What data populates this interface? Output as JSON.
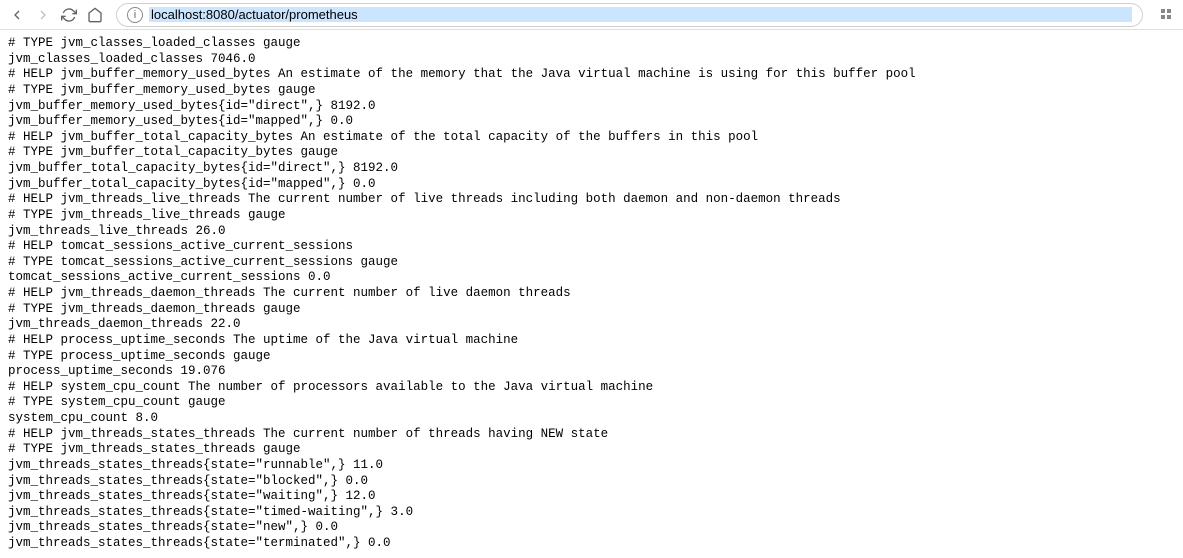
{
  "toolbar": {
    "url": "localhost:8080/actuator/prometheus"
  },
  "lines": [
    "# TYPE jvm_classes_loaded_classes gauge",
    "jvm_classes_loaded_classes 7046.0",
    "# HELP jvm_buffer_memory_used_bytes An estimate of the memory that the Java virtual machine is using for this buffer pool",
    "# TYPE jvm_buffer_memory_used_bytes gauge",
    "jvm_buffer_memory_used_bytes{id=\"direct\",} 8192.0",
    "jvm_buffer_memory_used_bytes{id=\"mapped\",} 0.0",
    "# HELP jvm_buffer_total_capacity_bytes An estimate of the total capacity of the buffers in this pool",
    "# TYPE jvm_buffer_total_capacity_bytes gauge",
    "jvm_buffer_total_capacity_bytes{id=\"direct\",} 8192.0",
    "jvm_buffer_total_capacity_bytes{id=\"mapped\",} 0.0",
    "# HELP jvm_threads_live_threads The current number of live threads including both daemon and non-daemon threads",
    "# TYPE jvm_threads_live_threads gauge",
    "jvm_threads_live_threads 26.0",
    "# HELP tomcat_sessions_active_current_sessions  ",
    "# TYPE tomcat_sessions_active_current_sessions gauge",
    "tomcat_sessions_active_current_sessions 0.0",
    "# HELP jvm_threads_daemon_threads The current number of live daemon threads",
    "# TYPE jvm_threads_daemon_threads gauge",
    "jvm_threads_daemon_threads 22.0",
    "# HELP process_uptime_seconds The uptime of the Java virtual machine",
    "# TYPE process_uptime_seconds gauge",
    "process_uptime_seconds 19.076",
    "# HELP system_cpu_count The number of processors available to the Java virtual machine",
    "# TYPE system_cpu_count gauge",
    "system_cpu_count 8.0",
    "# HELP jvm_threads_states_threads The current number of threads having NEW state",
    "# TYPE jvm_threads_states_threads gauge",
    "jvm_threads_states_threads{state=\"runnable\",} 11.0",
    "jvm_threads_states_threads{state=\"blocked\",} 0.0",
    "jvm_threads_states_threads{state=\"waiting\",} 12.0",
    "jvm_threads_states_threads{state=\"timed-waiting\",} 3.0",
    "jvm_threads_states_threads{state=\"new\",} 0.0",
    "jvm_threads_states_threads{state=\"terminated\",} 0.0"
  ]
}
